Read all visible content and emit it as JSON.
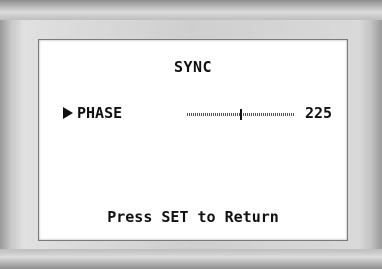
{
  "menu": {
    "title": "SYNC",
    "item": {
      "label": "PHASE",
      "value": "225",
      "slider_fraction": 0.5
    },
    "footer": "Press SET to Return"
  },
  "colors": {
    "text": "#111111",
    "screen": "#ffffff",
    "bezel": "#cfcfcf"
  }
}
